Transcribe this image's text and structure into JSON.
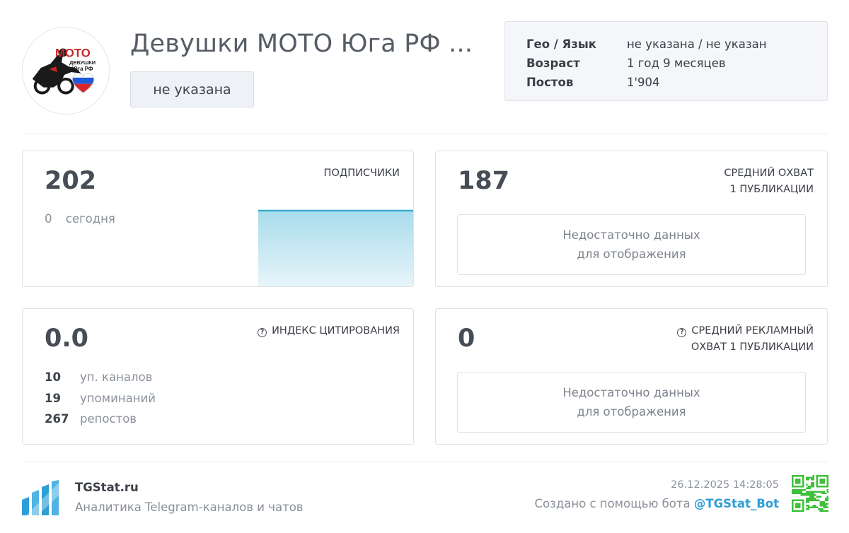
{
  "channel": {
    "avatar_text_top": "МОТО",
    "avatar_text_mid": "ДЕВУШКИ",
    "avatar_text_bottom": "Юга РФ",
    "title": "Девушки МОТО Юга РФ ...",
    "category": "не указана"
  },
  "info": [
    {
      "key": "Гео / Язык",
      "value": "не указана / не указан"
    },
    {
      "key": "Возраст",
      "value": "1 год 9 месяцев"
    },
    {
      "key": "Постов",
      "value": "1'904"
    }
  ],
  "subscribers": {
    "value": "202",
    "label": "ПОДПИСЧИКИ",
    "today_value": "0",
    "today_label": "сегодня"
  },
  "reach": {
    "value": "187",
    "label_line1": "СРЕДНИЙ ОХВАТ",
    "label_line2": "1 ПУБЛИКАЦИИ",
    "nodata_line1": "Недостаточно данных",
    "nodata_line2": "для отображения"
  },
  "citation": {
    "value": "0.0",
    "label": "ИНДЕКС ЦИТИРОВАНИЯ",
    "stats": [
      {
        "value": "10",
        "label": "уп. каналов"
      },
      {
        "value": "19",
        "label": "упоминаний"
      },
      {
        "value": "267",
        "label": "репостов"
      }
    ]
  },
  "ad_reach": {
    "value": "0",
    "label_line1": "СРЕДНИЙ РЕКЛАМНЫЙ",
    "label_line2": "ОХВАТ 1 ПУБЛИКАЦИИ",
    "nodata_line1": "Недостаточно данных",
    "nodata_line2": "для отображения"
  },
  "footer": {
    "brand": "TGStat.ru",
    "tagline": "Аналитика Telegram-каналов и чатов",
    "date": "26.12.2025 14:28:05",
    "created_by": "Создано с помощью бота",
    "bot": "@TGStat_Bot"
  },
  "colors": {
    "accent": "#2e9ed6",
    "spark_line": "#3aa9cf",
    "qr": "#3fbf3a"
  },
  "icons": [
    "help-circle-icon",
    "tgstat-logo-icon",
    "qr-code-icon"
  ]
}
